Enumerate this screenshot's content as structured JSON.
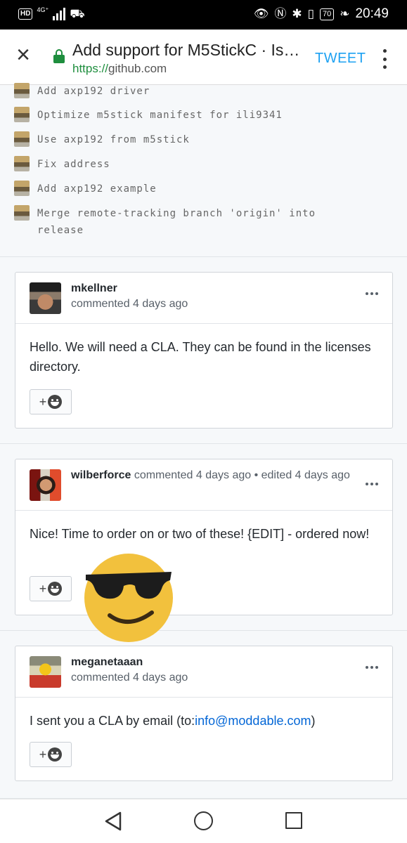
{
  "status_bar": {
    "hd": "HD",
    "network": "4G⁺",
    "battery": "70",
    "time": "20:49"
  },
  "toolbar": {
    "title": "Add support for M5StickC · Issu...",
    "url_protocol": "https://",
    "url_host": "github.com",
    "tweet_label": "TWEET"
  },
  "commits": [
    {
      "message": "Add axp192 driver"
    },
    {
      "message": "Optimize m5stick manifest for ili9341"
    },
    {
      "message": "Use axp192 from m5stick"
    },
    {
      "message": "Fix address"
    },
    {
      "message": "Add axp192 example"
    },
    {
      "message": "Merge remote-tracking branch 'origin' into release"
    }
  ],
  "comments": [
    {
      "author": "mkellner",
      "meta": "commented 4 days ago",
      "body": "Hello. We will need a CLA. They can be found in the licenses directory."
    },
    {
      "author": "wilberforce",
      "meta": "commented 4 days ago • edited 4 days ago",
      "body": "Nice! Time to order on or two of these! {EDIT] - ordered now!"
    },
    {
      "author": "meganetaaan",
      "meta": "commented 4 days ago",
      "body_prefix": "I sent you a CLA by email (to:",
      "body_link": "info@moddable.com",
      "body_suffix": ")"
    }
  ],
  "reaction_button_plus": "+",
  "colors": {
    "link": "#0366d6",
    "lock_green": "#1e8e3e",
    "tweet_blue": "#1da1f2",
    "emoji_yellow": "#f2c13d"
  },
  "icons": [
    "close-icon",
    "lock-icon",
    "more-vert-icon",
    "more-horiz-icon",
    "add-reaction-icon",
    "sunglasses-emoji-icon",
    "back-icon",
    "home-icon",
    "recents-icon"
  ]
}
